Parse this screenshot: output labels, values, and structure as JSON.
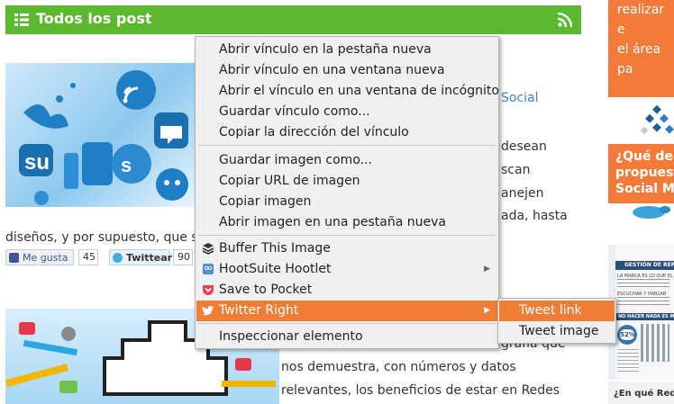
{
  "header": {
    "title": "Todos los post"
  },
  "sidebar": {
    "top_lines": [
      "realizar e",
      "el área pa"
    ],
    "mid_lines": [
      "¿Qué del",
      "propuest",
      "Social Me"
    ],
    "bottom_text": "¿En qué Redes S",
    "infographic": {
      "title": "GESTIÓN DE REPUTACI",
      "line1": "LA MARCA ES LO QUE EL",
      "line2": "ESCUCHAR Y HABLAR",
      "line3": "NO HACER NADA ES MÁS CA",
      "stat": "52%"
    }
  },
  "post1": {
    "title_fragment": "Social",
    "text_lines": [
      "desean",
      "scan",
      "anejen",
      "ada, hasta"
    ],
    "left_line": "diseños, y por supuesto, que s",
    "like_label": "Me gusta",
    "like_count": "45",
    "tweet_label": "Twittear",
    "tweet_count": "90"
  },
  "post2": {
    "text_lines": [
      "grafía que",
      "nos demuestra, con números y datos",
      "relevantes, los beneficios de estar en Redes"
    ]
  },
  "context_menu": {
    "items": [
      "Abrir vínculo en la pestaña nueva",
      "Abrir vínculo en una ventana nueva",
      "Abrir el vínculo en una ventana de incógnito",
      "Guardar vínculo como...",
      "Copiar la dirección del vínculo",
      "Guardar imagen como...",
      "Copiar URL de imagen",
      "Copiar imagen",
      "Abrir imagen en una pestaña nueva",
      "Buffer This Image",
      "HootSuite Hootlet",
      "Save to Pocket",
      "Twitter Right",
      "Inspeccionar elemento"
    ]
  },
  "submenu": {
    "items": [
      "Tweet link",
      "Tweet image"
    ]
  },
  "colors": {
    "header_green": "#5cb82e",
    "accent_orange": "#f07d36",
    "sidebar_orange": "#f47a3a"
  }
}
